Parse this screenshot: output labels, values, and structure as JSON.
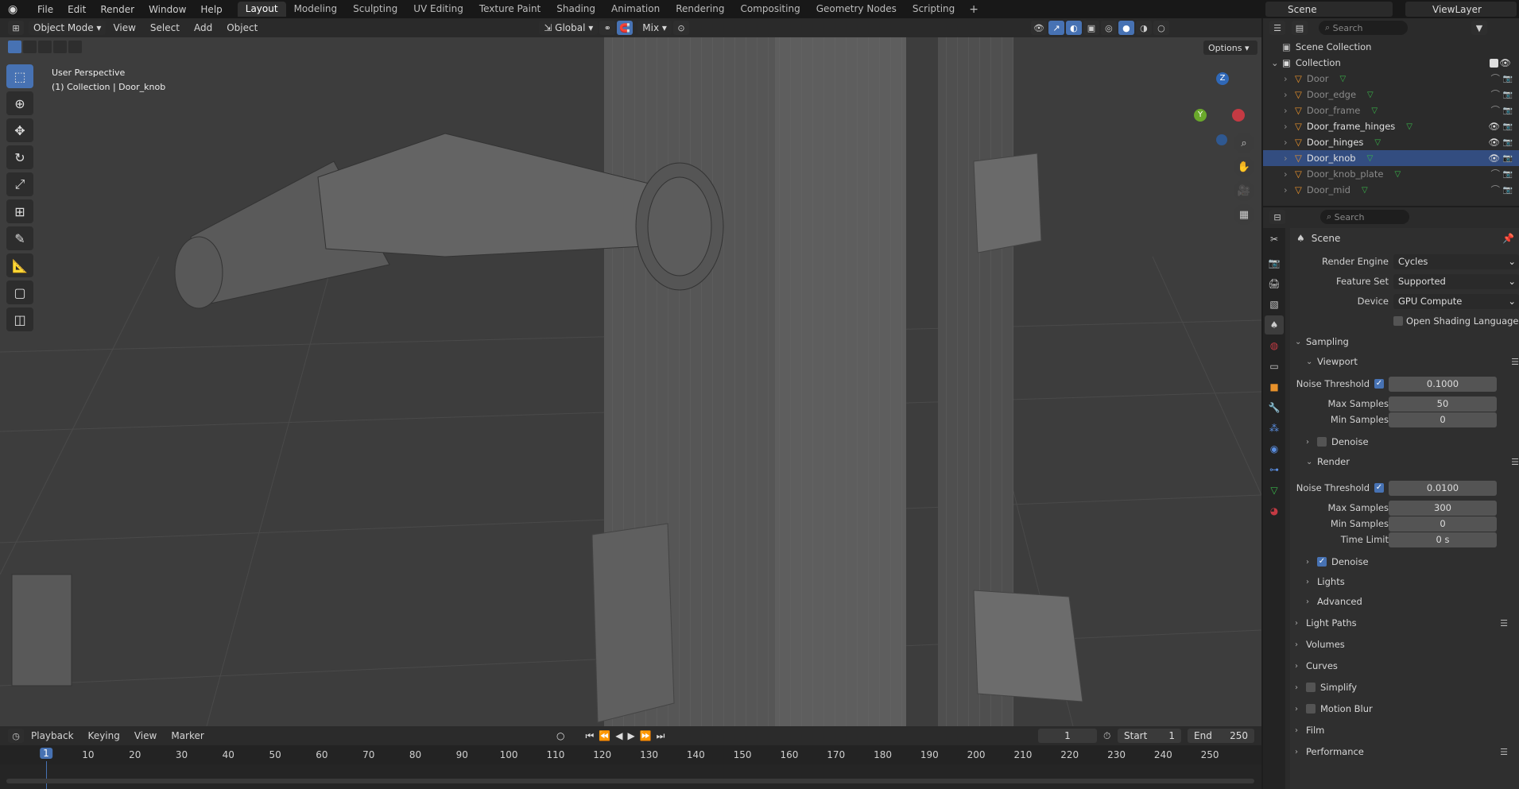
{
  "topbar": {
    "menus": [
      "File",
      "Edit",
      "Render",
      "Window",
      "Help"
    ],
    "workspaces": [
      "Layout",
      "Modeling",
      "Sculpting",
      "UV Editing",
      "Texture Paint",
      "Shading",
      "Animation",
      "Rendering",
      "Compositing",
      "Geometry Nodes",
      "Scripting"
    ],
    "active_workspace": "Layout",
    "scene": "Scene",
    "view_layer": "ViewLayer"
  },
  "viewport": {
    "mode": "Object Mode",
    "menus": [
      "View",
      "Select",
      "Add",
      "Object"
    ],
    "transform_orientation": "Global",
    "snap_mode": "Mix",
    "options_label": "Options",
    "perspective_label": "User Perspective",
    "collection_label": "(1) Collection | Door_knob",
    "gizmo_axes": {
      "z": "Z",
      "y": "Y"
    }
  },
  "timeline": {
    "menus": [
      "Playback",
      "Keying",
      "View",
      "Marker"
    ],
    "current_frame": "1",
    "start_label": "Start",
    "start": "1",
    "end_label": "End",
    "end": "250",
    "ticks": [
      "1",
      "10",
      "20",
      "30",
      "40",
      "50",
      "60",
      "70",
      "80",
      "90",
      "100",
      "110",
      "120",
      "130",
      "140",
      "150",
      "160",
      "170",
      "180",
      "190",
      "200",
      "210",
      "220",
      "230",
      "240",
      "250"
    ]
  },
  "outliner": {
    "search_placeholder": "Search",
    "scene_collection": "Scene Collection",
    "collection": "Collection",
    "objects": [
      {
        "name": "Door",
        "visible": false
      },
      {
        "name": "Door_edge",
        "visible": false
      },
      {
        "name": "Door_frame",
        "visible": false
      },
      {
        "name": "Door_frame_hinges",
        "visible": true
      },
      {
        "name": "Door_hinges",
        "visible": true
      },
      {
        "name": "Door_knob",
        "visible": true,
        "selected": true
      },
      {
        "name": "Door_knob_plate",
        "visible": false
      },
      {
        "name": "Door_mid",
        "visible": false
      }
    ]
  },
  "properties": {
    "search_placeholder": "Search",
    "context": "Scene",
    "render_engine_label": "Render Engine",
    "render_engine": "Cycles",
    "feature_set_label": "Feature Set",
    "feature_set": "Supported",
    "device_label": "Device",
    "device": "GPU Compute",
    "osl_label": "Open Shading Language",
    "sampling": "Sampling",
    "viewport": "Viewport",
    "vp_noise_label": "Noise Threshold",
    "vp_noise": "0.1000",
    "vp_max_label": "Max Samples",
    "vp_max": "50",
    "vp_min_label": "Min Samples",
    "vp_min": "0",
    "vp_denoise": "Denoise",
    "render": "Render",
    "r_noise_label": "Noise Threshold",
    "r_noise": "0.0100",
    "r_max_label": "Max Samples",
    "r_max": "300",
    "r_min_label": "Min Samples",
    "r_min": "0",
    "r_time_label": "Time Limit",
    "r_time": "0 s",
    "r_denoise": "Denoise",
    "lights": "Lights",
    "advanced": "Advanced",
    "light_paths": "Light Paths",
    "volumes": "Volumes",
    "curves": "Curves",
    "simplify": "Simplify",
    "motion_blur": "Motion Blur",
    "film": "Film",
    "performance": "Performance"
  }
}
